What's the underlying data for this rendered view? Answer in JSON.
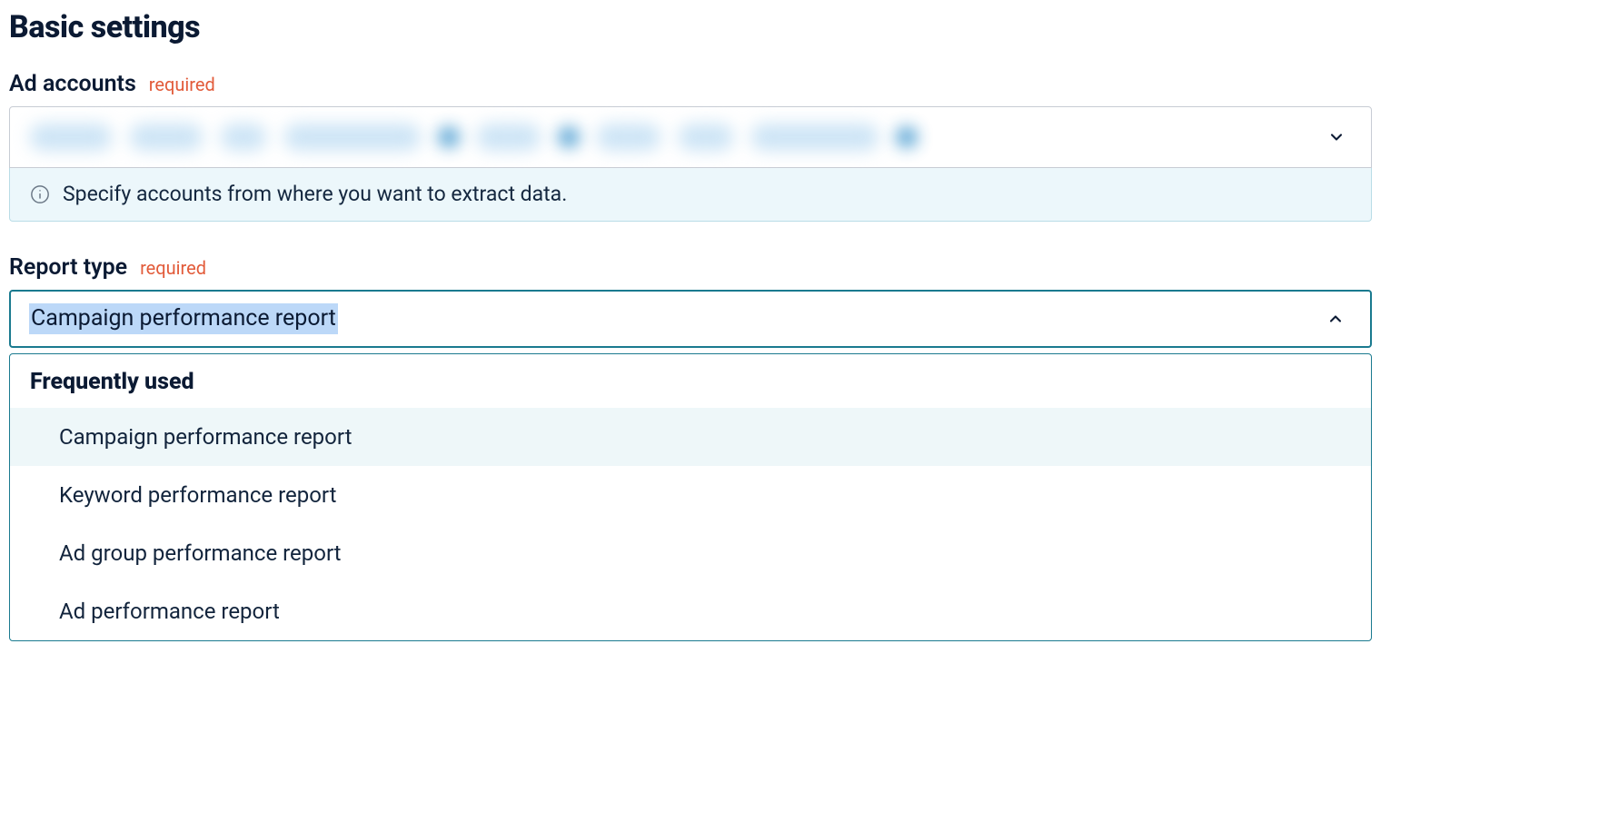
{
  "page": {
    "title": "Basic settings"
  },
  "ad_accounts": {
    "label": "Ad accounts",
    "required_tag": "required",
    "hint": "Specify accounts from where you want to extract data."
  },
  "report_type": {
    "label": "Report type",
    "required_tag": "required",
    "selected": "Campaign performance report",
    "group_header": "Frequently used",
    "options": [
      "Campaign performance report",
      "Keyword performance report",
      "Ad group performance report",
      "Ad performance report"
    ]
  }
}
